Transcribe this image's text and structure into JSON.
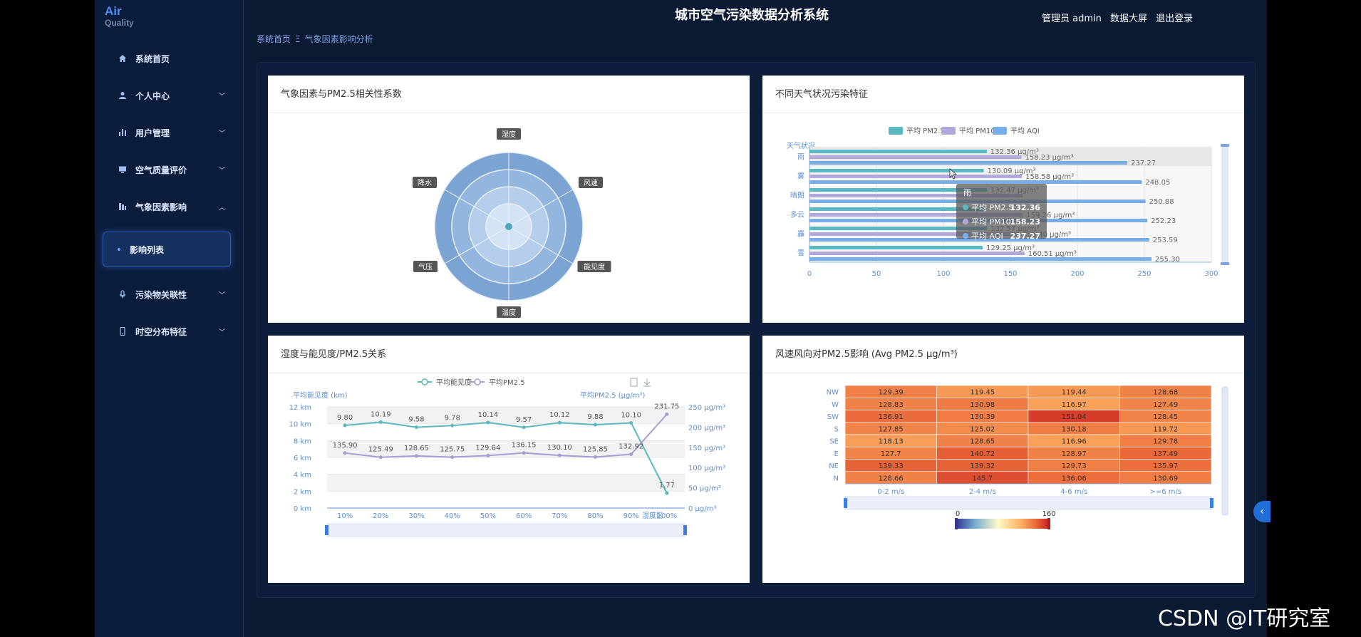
{
  "logo": {
    "line1": "Air",
    "line2": "Quality"
  },
  "header": {
    "title": "城市空气污染数据分析系统",
    "user": "管理员 admin",
    "screen": "数据大屏",
    "logout": "退出登录"
  },
  "sidebar": {
    "items": [
      {
        "label": "系统首页",
        "icon": "home-icon"
      },
      {
        "label": "个人中心",
        "icon": "user-icon"
      },
      {
        "label": "用户管理",
        "icon": "bar-icon"
      },
      {
        "label": "空气质量评价",
        "icon": "monitor-icon"
      },
      {
        "label": "气象因素影响",
        "icon": "chart-icon"
      },
      {
        "label": "污染物关联性",
        "icon": "mic-icon"
      },
      {
        "label": "时空分布特征",
        "icon": "phone-icon"
      }
    ],
    "active_sub": "影响列表"
  },
  "breadcrumb": {
    "home": "系统首页",
    "sep": "Ξ",
    "current": "气象因素影响分析"
  },
  "cards": {
    "radar": {
      "title": "气象因素与PM2.5相关性系数"
    },
    "weather": {
      "title": "不同天气状况污染特征"
    },
    "humidity": {
      "title": "湿度与能见度/PM2.5关系"
    },
    "wind": {
      "title": "风速风向对PM2.5影响 (Avg PM2.5 μg/m³)"
    }
  },
  "chart_data": [
    {
      "type": "radar",
      "indicators": [
        "湿度",
        "风速",
        "能见度",
        "温度",
        "气压",
        "降水"
      ]
    },
    {
      "type": "bar",
      "orientation": "horizontal",
      "ylabel": "天气状况",
      "categories": [
        "雨",
        "雾",
        "晴朗",
        "多云",
        "霾",
        "雪"
      ],
      "series": [
        {
          "name": "平均 PM2.5",
          "color": "#5ab8c2",
          "values": [
            132.36,
            130.09,
            132.47,
            131.28,
            132.57,
            129.25
          ],
          "labels": [
            "132.36 μg/m³",
            "130.09 μg/m³",
            "132.47 μg/m³",
            "",
            "132.57 μg/m³",
            "129.25 μg/m³"
          ]
        },
        {
          "name": "平均 PM10",
          "color": "#b2a8d9",
          "values": [
            158.23,
            158.58,
            159.1,
            159.26,
            156.4,
            160.51
          ],
          "labels": [
            "158.23 μg/m³",
            "158.58 μg/m³",
            "",
            "159.26 μg/m³",
            "156.40 μg/m³",
            "160.51 μg/m³"
          ]
        },
        {
          "name": "平均 AQI",
          "color": "#78aee8",
          "values": [
            237.27,
            248.05,
            250.88,
            252.23,
            253.59,
            255.3
          ],
          "labels": [
            "237.27",
            "248.05",
            "250.88",
            "252.23",
            "253.59",
            "255.30"
          ]
        }
      ],
      "xlim": [
        0,
        300
      ],
      "xticks": [
        0,
        50,
        100,
        150,
        200,
        250,
        300
      ],
      "tooltip": {
        "title": "雨",
        "rows": [
          {
            "name": "平均 PM2.5",
            "value": "132.36"
          },
          {
            "name": "平均 PM10",
            "value": "158.23"
          },
          {
            "name": "平均 AQI",
            "value": "237.27"
          }
        ]
      }
    },
    {
      "type": "line",
      "categories": [
        "10%",
        "20%",
        "30%",
        "40%",
        "50%",
        "60%",
        "70%",
        "80%",
        "90%",
        "100%"
      ],
      "xlabel": "湿度区",
      "ylabel_left": "平均能见度 (km)",
      "ylabel_right": "平均PM2.5 (μg/m³)",
      "left_ticks": [
        "0 km",
        "2 km",
        "4 km",
        "6 km",
        "8 km",
        "10 km",
        "12 km"
      ],
      "right_ticks": [
        "0 μg/m³",
        "50 μg/m³",
        "100 μg/m³",
        "150 μg/m³",
        "200 μg/m³",
        "250 μg/m³"
      ],
      "left_range": [
        0,
        12
      ],
      "right_range": [
        0,
        250
      ],
      "series": [
        {
          "name": "平均能见度",
          "color": "#5ab8c2",
          "axis": "left",
          "values": [
            9.8,
            10.19,
            9.58,
            9.78,
            10.14,
            9.57,
            10.12,
            9.88,
            10.1,
            1.77
          ],
          "labels": [
            "9.80",
            "10.19",
            "9.58",
            "9.78",
            "10.14",
            "9.57",
            "10.12",
            "9.88",
            "10.10",
            "1.77"
          ]
        },
        {
          "name": "平均PM2.5",
          "color": "#a89cd4",
          "axis": "right",
          "values": [
            135.9,
            125.49,
            128.65,
            125.75,
            129.64,
            136.15,
            130.1,
            125.85,
            132.92,
            231.75
          ],
          "labels": [
            "135.90",
            "125.49",
            "128.65",
            "125.75",
            "129.64",
            "136.15",
            "130.10",
            "125.85",
            "132.92",
            "231.75"
          ]
        }
      ]
    },
    {
      "type": "heatmap",
      "x": [
        "0-2 m/s",
        "2-4 m/s",
        "4-6 m/s",
        ">=6 m/s"
      ],
      "y": [
        "NW",
        "W",
        "SW",
        "S",
        "SE",
        "E",
        "NE",
        "N"
      ],
      "values": [
        [
          129.39,
          119.45,
          119.44,
          128.68
        ],
        [
          128.83,
          130.98,
          116.97,
          127.49
        ],
        [
          136.91,
          130.39,
          151.04,
          128.45
        ],
        [
          127.85,
          125.02,
          130.18,
          119.72
        ],
        [
          118.13,
          128.65,
          116.96,
          129.78
        ],
        [
          127.7,
          140.72,
          128.97,
          137.49
        ],
        [
          139.33,
          139.32,
          129.73,
          135.97
        ],
        [
          128.66,
          145.7,
          136.06,
          130.69
        ]
      ],
      "labels": [
        [
          "129.39",
          "119.45",
          "119.44",
          "128.68"
        ],
        [
          "128.83",
          "130.98",
          "116.97",
          "127.49"
        ],
        [
          "136.91",
          "130.39",
          "151.04",
          "128.45"
        ],
        [
          "127.85",
          "125.02",
          "130.18",
          "119.72"
        ],
        [
          "118.13",
          "128.65",
          "116.96",
          "129.78"
        ],
        [
          "127.7",
          "140.72",
          "128.97",
          "137.49"
        ],
        [
          "139.33",
          "139.32",
          "129.73",
          "135.97"
        ],
        [
          "128.66",
          "145.7",
          "136.06",
          "130.69"
        ]
      ],
      "visual_min": 0,
      "visual_max": 160
    }
  ],
  "watermark": "CSDN @IT研究室"
}
